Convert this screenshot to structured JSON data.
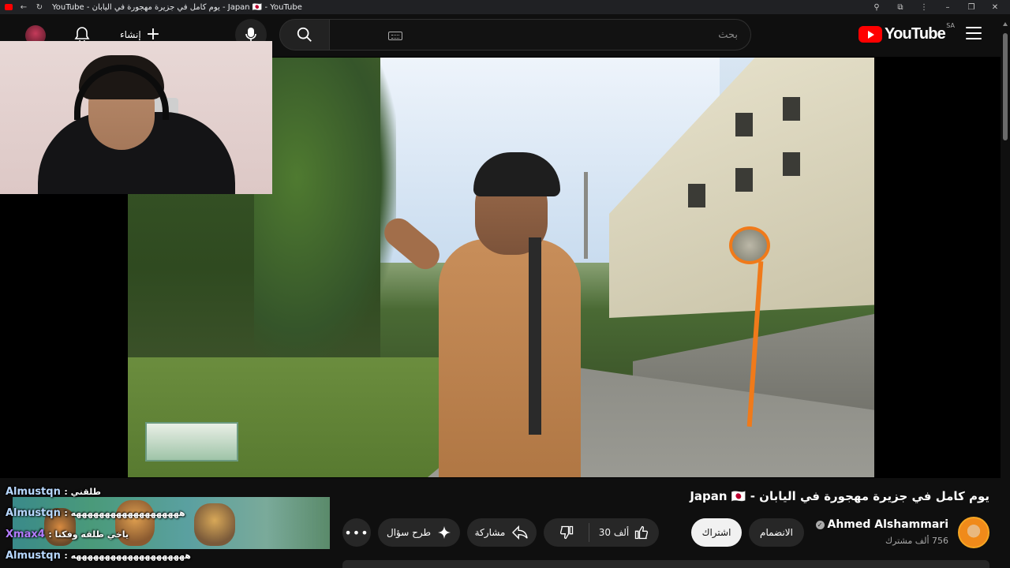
{
  "browser": {
    "tab_title": "YouTube - يوم كامل في جزيرة مهجورة في اليابان - Japan 🇯🇵 - YouTube"
  },
  "masthead": {
    "logo_text": "YouTube",
    "country_code": "SA",
    "search_placeholder": "بحث",
    "create_label": "إنشاء"
  },
  "video": {
    "title": "يوم كامل في جزيرة مهجورة في اليابان - Japan 🇯🇵",
    "channel_name": "Ahmed Alshammari",
    "subscribers": "756 ألف مشترك",
    "join_label": "الانضمام",
    "subscribe_label": "اشتراك",
    "like_count": "30 ألف",
    "share_label": "مشاركة",
    "ask_label": "طرح سؤال",
    "more_label": "•••"
  },
  "chat": {
    "lines": [
      {
        "user": "Almustqn",
        "message": "طلقني",
        "user_color": "#b8d8ff"
      },
      {
        "user": "Almustqn",
        "message": "هههههههههههههههههههه",
        "user_color": "#b8d8ff"
      },
      {
        "user": "Xmax4",
        "message": "ياخي طلقه وفكنا",
        "user_color": "#b47cff"
      },
      {
        "user": "Almustqn",
        "message": "ههههههههههههههههههههه",
        "user_color": "#b8d8ff"
      }
    ]
  },
  "colors": {
    "background": "#0f0f0f",
    "brand_red": "#ff0000",
    "pill": "#272727",
    "subscribe_bg": "#f1f1f1"
  }
}
